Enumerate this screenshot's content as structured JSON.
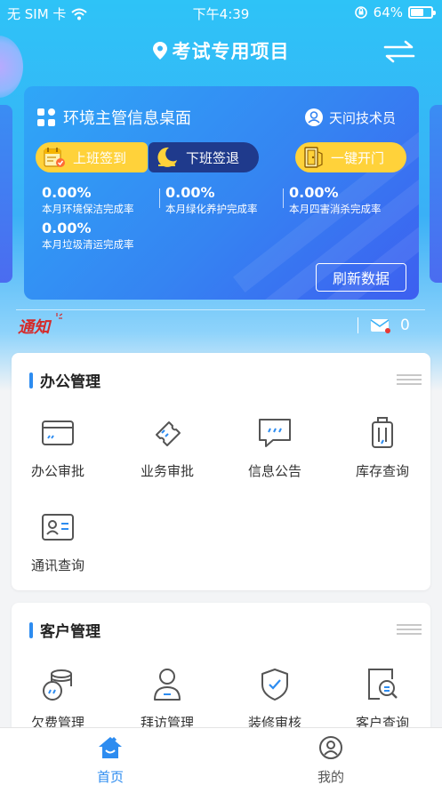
{
  "status_bar": {
    "carrier": "无 SIM 卡",
    "time": "下午4:39",
    "battery_percent": "64%",
    "battery_level": 0.64
  },
  "nav": {
    "title": "考试专用项目"
  },
  "card": {
    "title": "环境主管信息桌面",
    "user": "天问技术员",
    "checkin_label": "上班签到",
    "checkout_label": "下班签退",
    "door_label": "一键开门",
    "stats": [
      {
        "value": "0.00%",
        "label": "本月环境保洁完成率"
      },
      {
        "value": "0.00%",
        "label": "本月绿化养护完成率"
      },
      {
        "value": "0.00%",
        "label": "本月四害消杀完成率"
      },
      {
        "value": "0.00%",
        "label": "本月垃圾清运完成率"
      }
    ],
    "refresh_label": "刷新数据"
  },
  "notice": {
    "logo_text": "通知",
    "unread_count": "0"
  },
  "office": {
    "title": "办公管理",
    "items": [
      {
        "label": "办公审批",
        "icon": "card-icon"
      },
      {
        "label": "业务审批",
        "icon": "ticket-icon"
      },
      {
        "label": "信息公告",
        "icon": "message-icon"
      },
      {
        "label": "库存查询",
        "icon": "luggage-icon"
      },
      {
        "label": "通讯查询",
        "icon": "contact-card-icon"
      }
    ]
  },
  "customer": {
    "title": "客户管理",
    "items": [
      {
        "label": "欠费管理",
        "icon": "coins-icon"
      },
      {
        "label": "拜访管理",
        "icon": "person-icon"
      },
      {
        "label": "装修审核",
        "icon": "shield-check-icon"
      },
      {
        "label": "客户查询",
        "icon": "search-doc-icon"
      }
    ]
  },
  "tabs": [
    {
      "label": "首页",
      "icon": "home-icon",
      "active": true
    },
    {
      "label": "我的",
      "icon": "user-icon",
      "active": false
    }
  ],
  "colors": {
    "primary": "#2d8cf0",
    "accent_yellow": "#ffd23a",
    "checkout_bg": "#1f3a8c",
    "tab_active": "#2d8cf0",
    "tab_inactive": "#555555",
    "notice_red": "#d52a2a"
  }
}
